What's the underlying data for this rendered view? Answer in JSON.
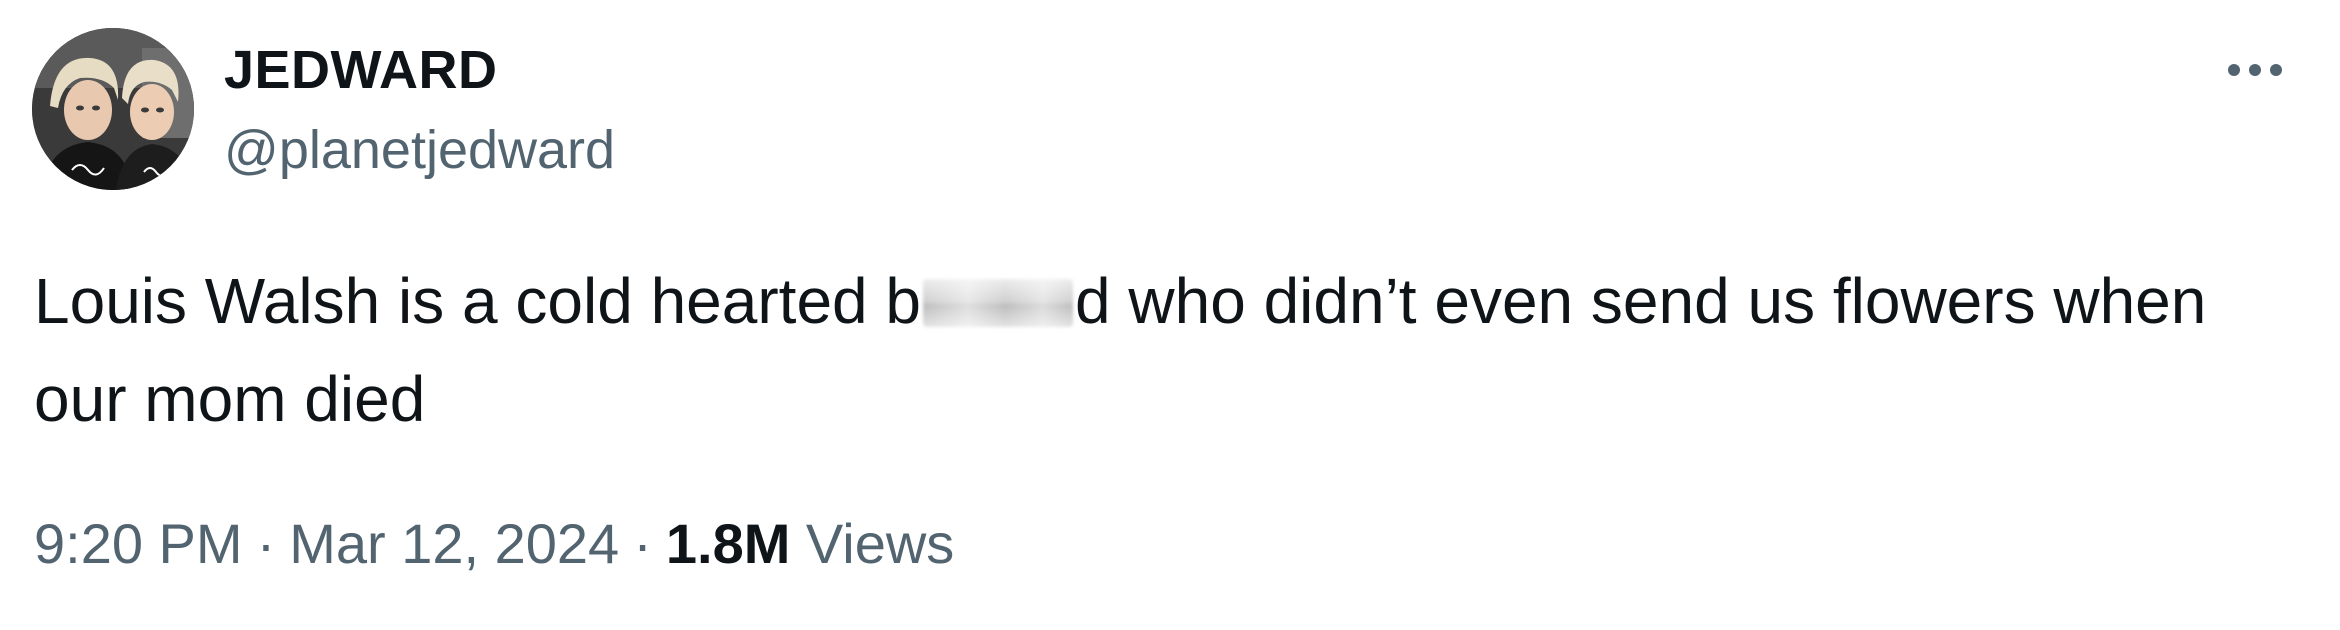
{
  "author": {
    "display_name": "JEDWARD",
    "handle": "@planetjedward",
    "avatar_icon": "profile-photo"
  },
  "tweet": {
    "text_before": "Louis Walsh is a cold hearted b",
    "text_after": "d who didn’t even send us flowers when our mom died"
  },
  "meta": {
    "time": "9:20 PM",
    "separator": "·",
    "date": "Mar 12, 2024",
    "views_count": "1.8M",
    "views_label": "Views"
  },
  "menu": {
    "more_icon": "more-horizontal-icon"
  },
  "colors": {
    "text_primary": "#0f1419",
    "text_secondary": "#536471",
    "background": "#ffffff"
  }
}
